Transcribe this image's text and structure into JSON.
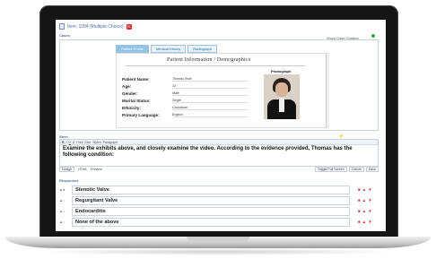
{
  "item": {
    "title": "Item: 1004 (Multiple Choice)",
    "badge": "R"
  },
  "cases": {
    "label": "Cases",
    "show_btn": "Show Case Content"
  },
  "tabs": [
    "Patient Profile",
    "Medical History",
    "Radiograph"
  ],
  "patient": {
    "title": "Patient Information / Demographics",
    "photo_label": "Photograph",
    "rows": [
      {
        "label": "Patient Name:",
        "value": "Thomas Roth"
      },
      {
        "label": "Age:",
        "value": "31"
      },
      {
        "label": "Gender:",
        "value": "Male"
      },
      {
        "label": "Marital Status:",
        "value": "Single"
      },
      {
        "label": "Ethnicity:",
        "value": "Caucasian"
      },
      {
        "label": "Primary Language:",
        "value": "English"
      }
    ]
  },
  "stem": {
    "label": "Stem",
    "text": "Examine the exhibits above, and closely examine the video. According to the evidence provided, Thomas has the following condition:",
    "toolbar": [
      "B",
      "I",
      "U",
      "A",
      "Font",
      "Size",
      "Styles",
      "Paragraph"
    ],
    "bottom": {
      "design": "Design",
      "html": "HTML",
      "preview": "Preview",
      "toggle": "Toggle Full Screen",
      "cancel": "Cancel",
      "save": "Save"
    }
  },
  "responses": {
    "label": "Responses",
    "items": [
      {
        "text": "Stenotic Valve"
      },
      {
        "text": "Regurgitant Valve"
      },
      {
        "text": "Endocarditis"
      },
      {
        "text": "None of the above"
      }
    ]
  }
}
